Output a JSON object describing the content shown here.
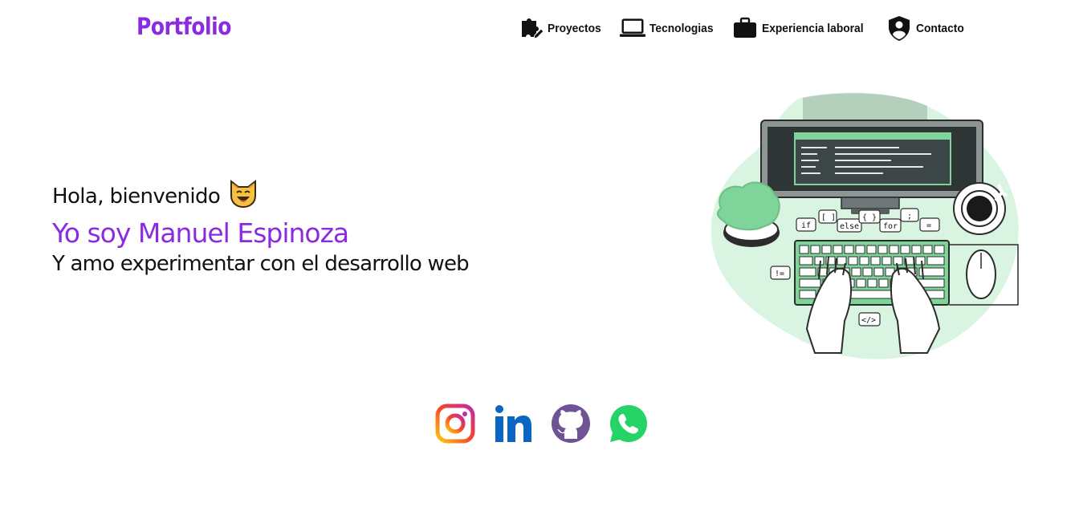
{
  "header": {
    "logo": "Portfolio",
    "nav": [
      {
        "label": "Proyectos",
        "icon": "puzzle-icon"
      },
      {
        "label": "Tecnologias",
        "icon": "laptop-icon"
      },
      {
        "label": "Experiencia laboral",
        "icon": "briefcase-icon"
      },
      {
        "label": "Contacto",
        "icon": "user-shield-icon"
      }
    ]
  },
  "hero": {
    "greeting": "Hola, bienvenido",
    "name": "Yo soy Manuel Espinoza",
    "tagline": "Y amo experimentar con el desarrollo web"
  },
  "illustration": {
    "bubbles": [
      "if",
      "[ ]",
      "else",
      "{ }",
      "for",
      ";",
      "=",
      "!=",
      "</>"
    ]
  },
  "socials": [
    {
      "name": "instagram",
      "icon": "instagram-icon"
    },
    {
      "name": "linkedin",
      "icon": "linkedin-icon",
      "text": "in"
    },
    {
      "name": "github",
      "icon": "github-icon"
    },
    {
      "name": "whatsapp",
      "icon": "whatsapp-icon"
    }
  ],
  "colors": {
    "accent": "#8a2be2",
    "instagram_start": "#fdc90b",
    "instagram_end": "#c32aa3",
    "linkedin": "#0a66c2",
    "github": "#6e5494",
    "whatsapp": "#25d366",
    "illustration_green": "#7fd49a",
    "illustration_blob": "#d9f5e1"
  }
}
